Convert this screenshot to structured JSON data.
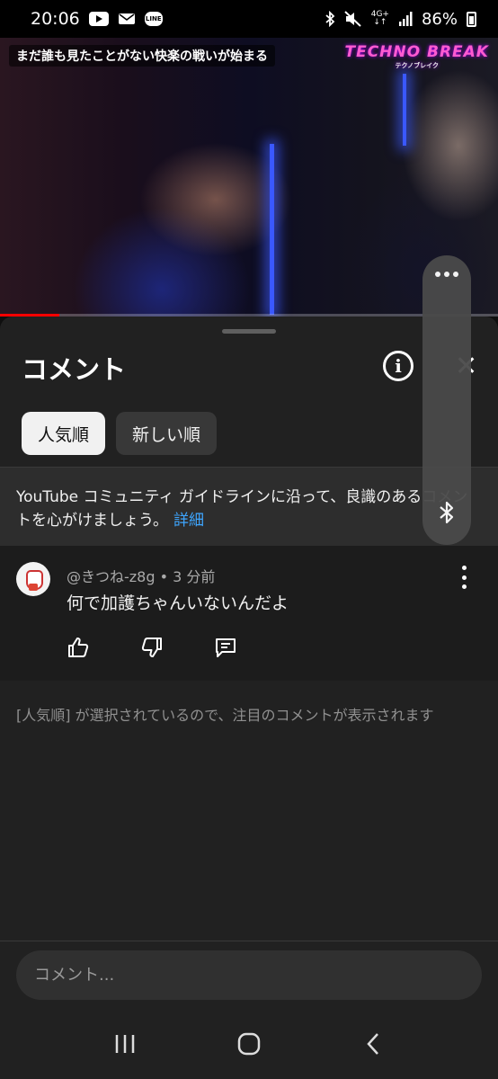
{
  "status_bar": {
    "time": "20:06",
    "line_badge": "LINE",
    "network_label": "4G+",
    "battery": "86%"
  },
  "video": {
    "caption": "まだ誰も見たことがない快楽の戦いが始まる",
    "logo_text": "TECHNO BREAK",
    "logo_sub": "テクノブレイク",
    "progress_fraction": 0.12,
    "progress_color": "#ff0000"
  },
  "sheet": {
    "title": "コメント",
    "close_glyph": "✕",
    "info_glyph": "i",
    "chips": [
      {
        "label": "人気順",
        "active": true
      },
      {
        "label": "新しい順",
        "active": false
      }
    ],
    "guideline_text": "YouTube コミュニティ ガイドラインに沿って、良識のあるコメントを心がけましょう。",
    "guideline_more": "詳細"
  },
  "comment": {
    "author": "@きつね-z8g",
    "time_ago": "3 分前",
    "separator": "•",
    "text": "何で加護ちゃんいないんだよ"
  },
  "sort_note": "[人気順] が選択されているので、注目のコメントが表示されます",
  "composer": {
    "placeholder": "コメント..."
  },
  "colors": {
    "accent_link": "#3ea6ff",
    "sheet_bg": "#212121"
  }
}
